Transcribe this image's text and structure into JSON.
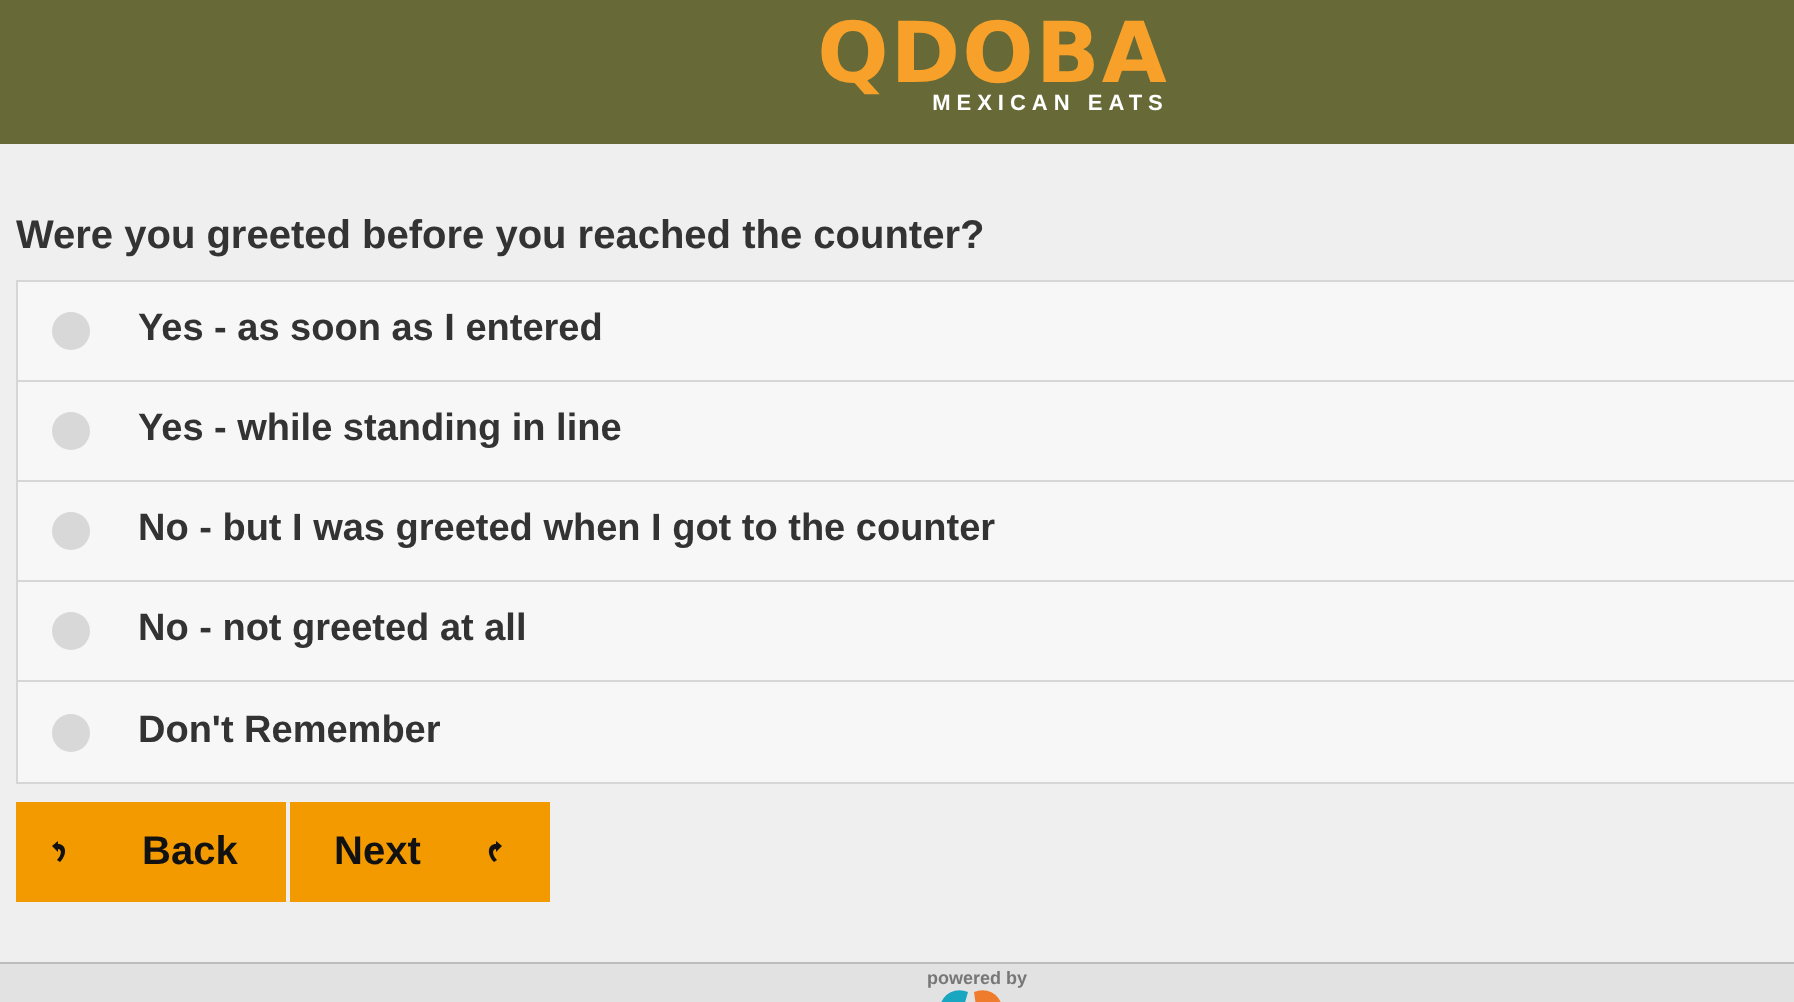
{
  "header": {
    "logo_title": "QDOBA",
    "logo_subtitle": "MEXICAN EATS"
  },
  "question": "Were you greeted before you reached the counter?",
  "options": [
    {
      "label": "Yes - as soon as I entered",
      "selected": false
    },
    {
      "label": "Yes - while standing in line",
      "selected": false
    },
    {
      "label": "No - but I was greeted when I got to the counter",
      "selected": false
    },
    {
      "label": "No - not greeted at all",
      "selected": false
    },
    {
      "label": "Don't Remember",
      "selected": false
    }
  ],
  "buttons": [
    {
      "label": "Back",
      "kind": "back"
    },
    {
      "label": "Next",
      "kind": "next"
    }
  ],
  "footer": {
    "powered_by": "powered by"
  }
}
